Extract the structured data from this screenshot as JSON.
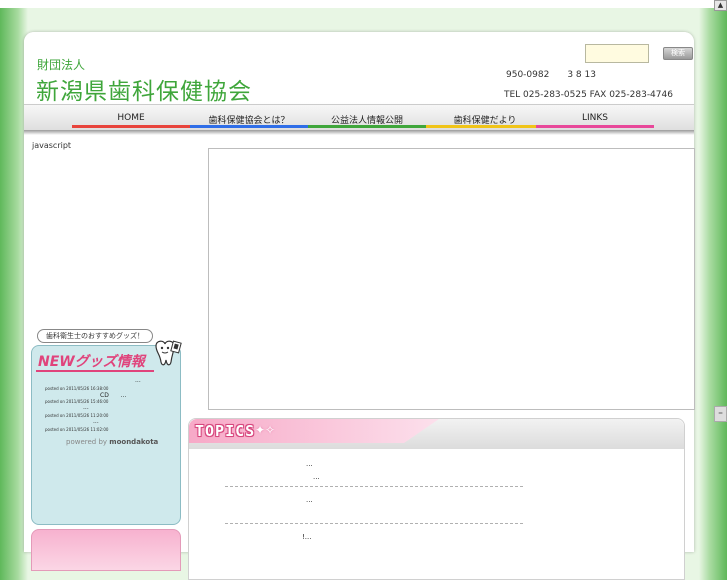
{
  "header": {
    "org_type": "財団法人",
    "org_name": "新潟県歯科保健協会",
    "address": "950-0982　　3 8 13",
    "tel_fax": "TEL 025-283-0525 FAX 025-283-4746",
    "search_placeholder": "",
    "search_button": "検索"
  },
  "nav": {
    "items": [
      {
        "label": "HOME",
        "color": "#e8443c"
      },
      {
        "label": "歯科保健協会とは？",
        "color": "#2f6ee8"
      },
      {
        "label": "公益法人情報公開",
        "color": "#3fa63b"
      },
      {
        "label": "歯科保健だより",
        "color": "#f0c418"
      },
      {
        "label": "LINKS",
        "color": "#e8489a"
      }
    ]
  },
  "main": {
    "js_notice": "javascript"
  },
  "sidebar": {
    "speech": "歯科衛生士のおすすめグッズ！",
    "title": "NEWグッズ情報",
    "posts": [
      {
        "title": "...",
        "date": "posted on 2011/05/26 16:38:00"
      },
      {
        "title": "CD　　...",
        "date": "posted on 2011/05/26 15:46:00"
      },
      {
        "title": "...",
        "date": "posted on 2011/05/26 11:20:00"
      },
      {
        "title": "...",
        "date": "posted on 2011/05/26 11:02:00"
      }
    ],
    "powered_prefix": "powered by",
    "powered_name": "moondakota"
  },
  "topics": {
    "title": "TOPICS",
    "items": [
      {
        "line1": "...",
        "line2": "..."
      },
      {
        "line1": "...",
        "line2": ""
      },
      {
        "line1": "!...",
        "line2": ""
      }
    ]
  },
  "colors": {
    "brand_green": "#3fa63b",
    "accent_pink": "#e0447c"
  }
}
